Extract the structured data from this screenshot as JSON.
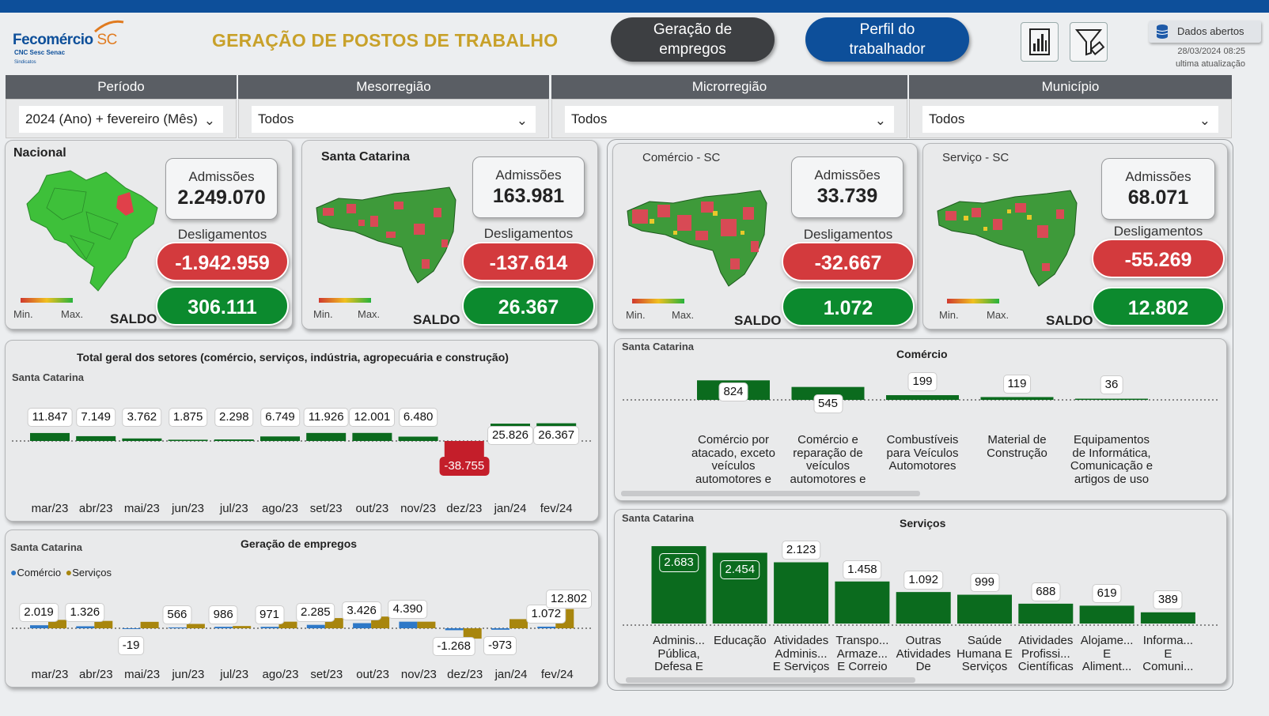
{
  "header": {
    "logo_name": "Fecomércio",
    "logo_sc": "SC",
    "logo_sub": "CNC Sesc Senac",
    "logo_sub2": "Sindicatos",
    "title": "GERAÇÃO DE POSTOS DE TRABALHO",
    "nav": {
      "geracao_l1": "Geração de",
      "geracao_l2": "empregos",
      "perfil_l1": "Perfil do",
      "perfil_l2": "trabalhador"
    },
    "dados_abertos": "Dados abertos",
    "update_time": "28/03/2024 08:25",
    "update_label": "ultima atualização"
  },
  "filters": {
    "periodo": {
      "label": "Período",
      "value": "2024 (Ano) + fevereiro (Mês)"
    },
    "mesorregiao": {
      "label": "Mesorregião",
      "value": "Todos"
    },
    "microrregiao": {
      "label": "Microrregião",
      "value": "Todos"
    },
    "municipio": {
      "label": "Município",
      "value": "Todos"
    }
  },
  "kpis": {
    "nacional": {
      "title": "Nacional",
      "admissoes_label": "Admissões",
      "admissoes": "2.249.070",
      "desligamentos_label": "Desligamentos",
      "desligamentos": "-1.942.959",
      "saldo_label": "SALDO",
      "saldo": "306.111",
      "min": "Min.",
      "max": "Max."
    },
    "sc": {
      "title": "Santa Catarina",
      "admissoes_label": "Admissões",
      "admissoes": "163.981",
      "desligamentos_label": "Desligamentos",
      "desligamentos": "-137.614",
      "saldo_label": "SALDO",
      "saldo": "26.367",
      "min": "Min.",
      "max": "Max."
    },
    "comercio": {
      "title": "Comércio - SC",
      "admissoes_label": "Admissões",
      "admissoes": "33.739",
      "desligamentos_label": "Desligamentos",
      "desligamentos": "-32.667",
      "saldo_label": "SALDO",
      "saldo": "1.072",
      "min": "Min.",
      "max": "Max."
    },
    "servico": {
      "title": "Serviço - SC",
      "admissoes_label": "Admissões",
      "admissoes": "68.071",
      "desligamentos_label": "Desligamentos",
      "desligamentos": "-55.269",
      "saldo_label": "SALDO",
      "saldo": "12.802",
      "min": "Min.",
      "max": "Max."
    }
  },
  "colors": {
    "positive": "#0b6b1e",
    "negative": "#c41e2a",
    "comercio": "#2e78c7",
    "servicos": "#a8860e",
    "nav_dark": "#3d3f42",
    "nav_blue": "#0d4f9a"
  },
  "chart_data": [
    {
      "type": "bar",
      "title": "Total geral dos setores (comércio, serviços, indústria, agropecuária e construção)",
      "subtitle": "Santa Catarina",
      "categories": [
        "mar/23",
        "abr/23",
        "mai/23",
        "jun/23",
        "jul/23",
        "ago/23",
        "set/23",
        "out/23",
        "nov/23",
        "dez/23",
        "jan/24",
        "fev/24"
      ],
      "values": [
        11847,
        7149,
        3762,
        1875,
        2298,
        6749,
        11926,
        12001,
        6480,
        -38755,
        25826,
        26367
      ],
      "labels": [
        "11.847",
        "7.149",
        "3.762",
        "1.875",
        "2.298",
        "6.749",
        "11.926",
        "12.001",
        "6.480",
        "-38.755",
        "25.826",
        "26.367"
      ]
    },
    {
      "type": "bar",
      "title": "Geração de empregos",
      "subtitle": "Santa Catarina",
      "categories": [
        "mar/23",
        "abr/23",
        "mai/23",
        "jun/23",
        "jul/23",
        "ago/23",
        "set/23",
        "out/23",
        "nov/23",
        "dez/23",
        "jan/24",
        "fev/24"
      ],
      "series": [
        {
          "name": "Comércio",
          "values": [
            2019,
            1326,
            -19,
            566,
            986,
            971,
            2285,
            3426,
            4390,
            -1268,
            -973,
            1072
          ]
        },
        {
          "name": "Serviços",
          "values": [
            5600,
            4900,
            4300,
            2900,
            1500,
            4400,
            6800,
            7800,
            4400,
            -6900,
            6100,
            12802
          ]
        }
      ],
      "labels": [
        "2.019",
        "1.326",
        "-19",
        "566",
        "986",
        "971",
        "2.285",
        "3.426",
        "4.390",
        "-1.268",
        "-973",
        "1.072",
        "12.802"
      ]
    },
    {
      "type": "bar",
      "title": "Comércio",
      "subtitle": "Santa Catarina",
      "categories": [
        "Comércio por atacado, exceto veículos automotores e motocicletas",
        "Comércio e reparação de veículos automotores e motocicletas",
        "Combustíveis para Veículos Automotores",
        "Material de Construção",
        "Equipamentos de Informática, Comunicação e artigos de uso doméstico"
      ],
      "values": [
        824,
        545,
        199,
        119,
        36
      ],
      "labels": [
        "824",
        "545",
        "199",
        "119",
        "36"
      ]
    },
    {
      "type": "bar",
      "title": "Serviços",
      "subtitle": "Santa Catarina",
      "categories": [
        "Adminis... Pública, Defesa E Seguridade",
        "Educação",
        "Atividades Adminis... E Serviços Complem...",
        "Transpo... Armaze... E Correio",
        "Outras Atividades De Serviços",
        "Saúde Humana E Serviços Sociais",
        "Atividades Profissi... Científicas E Técnicas",
        "Alojame... E Aliment...",
        "Informa... E Comuni..."
      ],
      "values": [
        2683,
        2454,
        2123,
        1458,
        1092,
        999,
        688,
        619,
        389
      ],
      "labels": [
        "2.683",
        "2.454",
        "2.123",
        "1.458",
        "1.092",
        "999",
        "688",
        "619",
        "389"
      ]
    }
  ],
  "chart_legend": {
    "comercio": "Comércio",
    "servicos": "Serviços"
  },
  "catlabels_comercio": [
    [
      "Comércio por",
      "atacado, exceto",
      "veículos",
      "automotores e",
      "motocicletas"
    ],
    [
      "Comércio e",
      "reparação de",
      "veículos",
      "automotores e",
      "motocicletas"
    ],
    [
      "Combustíveis",
      "para Veículos",
      "Automotores"
    ],
    [
      "Material de",
      "Construção"
    ],
    [
      "Equipamentos",
      "de Informática,",
      "Comunicação e",
      "artigos de uso",
      "doméstico"
    ]
  ],
  "catlabels_servicos": [
    [
      "Adminis...",
      "Pública,",
      "Defesa E",
      "Seguridade"
    ],
    [
      "Educação"
    ],
    [
      "Atividades",
      "Adminis...",
      "E Serviços",
      "Complem..."
    ],
    [
      "Transpo...",
      "Armaze...",
      "E Correio"
    ],
    [
      "Outras",
      "Atividades",
      "De",
      "Serviços"
    ],
    [
      "Saúde",
      "Humana E",
      "Serviços",
      "Sociais"
    ],
    [
      "Atividades",
      "Profissi...",
      "Científicas",
      "E Técnicas"
    ],
    [
      "Alojame...",
      "E",
      "Aliment..."
    ],
    [
      "Informa...",
      "E",
      "Comuni..."
    ]
  ]
}
